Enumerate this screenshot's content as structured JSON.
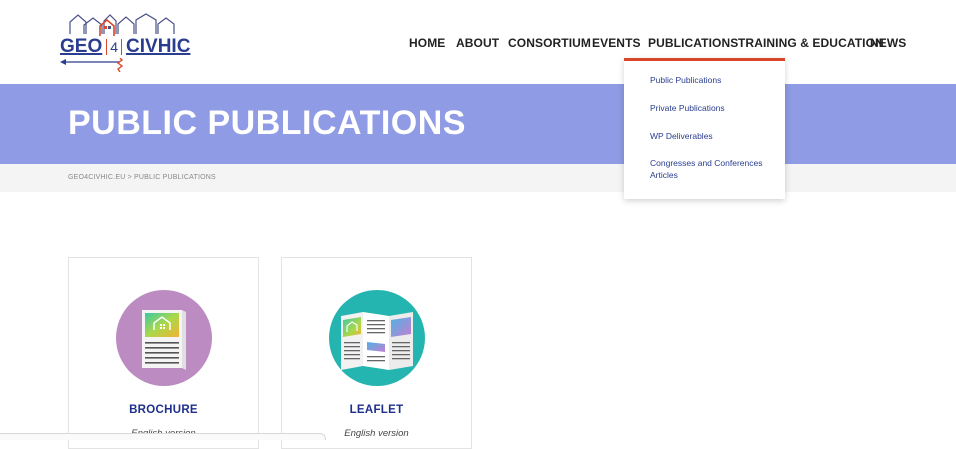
{
  "logo": {
    "part1": "GEO",
    "part2": "4",
    "part3": "CIVHIC"
  },
  "nav": [
    {
      "label": "HOME"
    },
    {
      "label": "ABOUT"
    },
    {
      "label": "CONSORTIUM"
    },
    {
      "label": "EVENTS"
    },
    {
      "label": "PUBLICATIONS"
    },
    {
      "label": "TRAINING & EDUCATION"
    },
    {
      "label": "NEWS"
    }
  ],
  "dropdown": {
    "items": [
      {
        "label": "Public Publications"
      },
      {
        "label": "Private Publications"
      },
      {
        "label": "WP Deliverables"
      },
      {
        "label": "Congresses and Conferences Articles"
      }
    ]
  },
  "hero": {
    "title": "PUBLIC PUBLICATIONS"
  },
  "breadcrumb": {
    "text": "GEO4CIVHIC.EU > PUBLIC PUBLICATIONS"
  },
  "cards": [
    {
      "title": "BROCHURE",
      "subtitle": "English version",
      "icon": "brochure-icon",
      "color": "#bb8bc1"
    },
    {
      "title": "LEAFLET",
      "subtitle": "English version",
      "icon": "leaflet-icon",
      "color": "#25b5b0"
    }
  ],
  "colors": {
    "hero": "#8f9be4",
    "accent": "#d9472b",
    "link": "#2a3d8f",
    "title": "#1e2f8c"
  }
}
